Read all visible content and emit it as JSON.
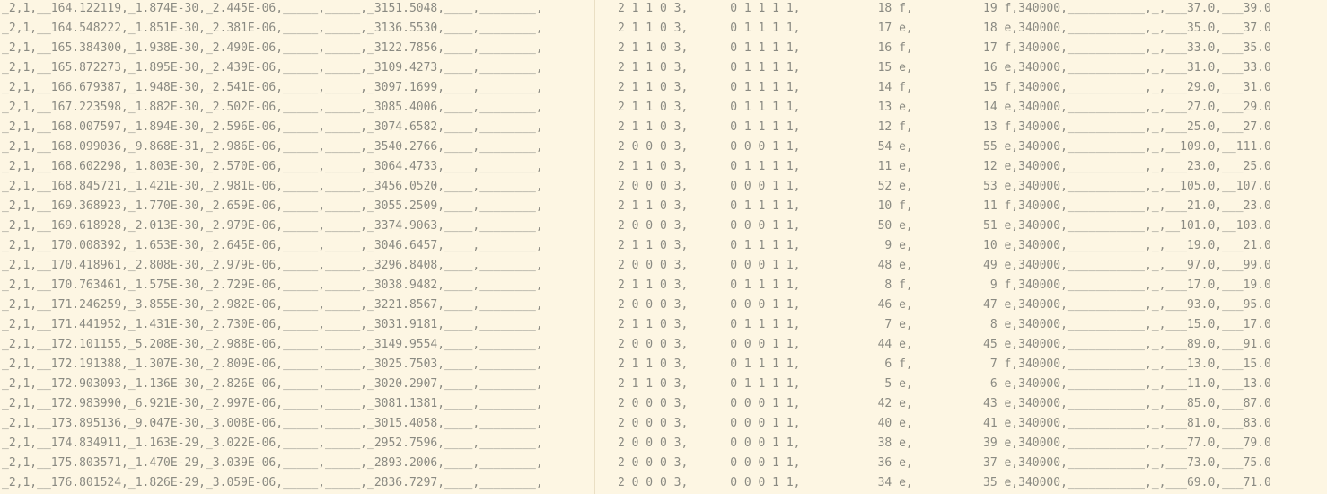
{
  "lines": [
    {
      "left": "_2,1,__164.122119,_1.874E-30,_2.445E-06,_____,_____,_3151.5048,____,________,",
      "right": "2 1 1 0 3,      0 1 1 1 1,           18 f,          19 f,340000,___________,_,___37.0,___39.0"
    },
    {
      "left": "_2,1,__164.548222,_1.851E-30,_2.381E-06,_____,_____,_3136.5530,____,________,",
      "right": "2 1 1 0 3,      0 1 1 1 1,           17 e,          18 e,340000,___________,_,___35.0,___37.0"
    },
    {
      "left": "_2,1,__165.384300,_1.938E-30,_2.490E-06,_____,_____,_3122.7856,____,________,",
      "right": "2 1 1 0 3,      0 1 1 1 1,           16 f,          17 f,340000,___________,_,___33.0,___35.0"
    },
    {
      "left": "_2,1,__165.872273,_1.895E-30,_2.439E-06,_____,_____,_3109.4273,____,________,",
      "right": "2 1 1 0 3,      0 1 1 1 1,           15 e,          16 e,340000,___________,_,___31.0,___33.0"
    },
    {
      "left": "_2,1,__166.679387,_1.948E-30,_2.541E-06,_____,_____,_3097.1699,____,________,",
      "right": "2 1 1 0 3,      0 1 1 1 1,           14 f,          15 f,340000,___________,_,___29.0,___31.0"
    },
    {
      "left": "_2,1,__167.223598,_1.882E-30,_2.502E-06,_____,_____,_3085.4006,____,________,",
      "right": "2 1 1 0 3,      0 1 1 1 1,           13 e,          14 e,340000,___________,_,___27.0,___29.0"
    },
    {
      "left": "_2,1,__168.007597,_1.894E-30,_2.596E-06,_____,_____,_3074.6582,____,________,",
      "right": "2 1 1 0 3,      0 1 1 1 1,           12 f,          13 f,340000,___________,_,___25.0,___27.0"
    },
    {
      "left": "_2,1,__168.099036,_9.868E-31,_2.986E-06,_____,_____,_3540.2766,____,________,",
      "right": "2 0 0 0 3,      0 0 0 1 1,           54 e,          55 e,340000,___________,_,__109.0,__111.0"
    },
    {
      "left": "_2,1,__168.602298,_1.803E-30,_2.570E-06,_____,_____,_3064.4733,____,________,",
      "right": "2 1 1 0 3,      0 1 1 1 1,           11 e,          12 e,340000,___________,_,___23.0,___25.0"
    },
    {
      "left": "_2,1,__168.845721,_1.421E-30,_2.981E-06,_____,_____,_3456.0520,____,________,",
      "right": "2 0 0 0 3,      0 0 0 1 1,           52 e,          53 e,340000,___________,_,__105.0,__107.0"
    },
    {
      "left": "_2,1,__169.368923,_1.770E-30,_2.659E-06,_____,_____,_3055.2509,____,________,",
      "right": "2 1 1 0 3,      0 1 1 1 1,           10 f,          11 f,340000,___________,_,___21.0,___23.0"
    },
    {
      "left": "_2,1,__169.618928,_2.013E-30,_2.979E-06,_____,_____,_3374.9063,____,________,",
      "right": "2 0 0 0 3,      0 0 0 1 1,           50 e,          51 e,340000,___________,_,__101.0,__103.0"
    },
    {
      "left": "_2,1,__170.008392,_1.653E-30,_2.645E-06,_____,_____,_3046.6457,____,________,",
      "right": "2 1 1 0 3,      0 1 1 1 1,            9 e,          10 e,340000,___________,_,___19.0,___21.0"
    },
    {
      "left": "_2,1,__170.418961,_2.808E-30,_2.979E-06,_____,_____,_3296.8408,____,________,",
      "right": "2 0 0 0 3,      0 0 0 1 1,           48 e,          49 e,340000,___________,_,___97.0,___99.0"
    },
    {
      "left": "_2,1,__170.763461,_1.575E-30,_2.729E-06,_____,_____,_3038.9482,____,________,",
      "right": "2 1 1 0 3,      0 1 1 1 1,            8 f,           9 f,340000,___________,_,___17.0,___19.0"
    },
    {
      "left": "_2,1,__171.246259,_3.855E-30,_2.982E-06,_____,_____,_3221.8567,____,________,",
      "right": "2 0 0 0 3,      0 0 0 1 1,           46 e,          47 e,340000,___________,_,___93.0,___95.0"
    },
    {
      "left": "_2,1,__171.441952,_1.431E-30,_2.730E-06,_____,_____,_3031.9181,____,________,",
      "right": "2 1 1 0 3,      0 1 1 1 1,            7 e,           8 e,340000,___________,_,___15.0,___17.0"
    },
    {
      "left": "_2,1,__172.101155,_5.208E-30,_2.988E-06,_____,_____,_3149.9554,____,________,",
      "right": "2 0 0 0 3,      0 0 0 1 1,           44 e,          45 e,340000,___________,_,___89.0,___91.0"
    },
    {
      "left": "_2,1,__172.191388,_1.307E-30,_2.809E-06,_____,_____,_3025.7503,____,________,",
      "right": "2 1 1 0 3,      0 1 1 1 1,            6 f,           7 f,340000,___________,_,___13.0,___15.0"
    },
    {
      "left": "_2,1,__172.903093,_1.136E-30,_2.826E-06,_____,_____,_3020.2907,____,________,",
      "right": "2 1 1 0 3,      0 1 1 1 1,            5 e,           6 e,340000,___________,_,___11.0,___13.0"
    },
    {
      "left": "_2,1,__172.983990,_6.921E-30,_2.997E-06,_____,_____,_3081.1381,____,________,",
      "right": "2 0 0 0 3,      0 0 0 1 1,           42 e,          43 e,340000,___________,_,___85.0,___87.0"
    },
    {
      "left": "_2,1,__173.895136,_9.047E-30,_3.008E-06,_____,_____,_3015.4058,____,________,",
      "right": "2 0 0 0 3,      0 0 0 1 1,           40 e,          41 e,340000,___________,_,___81.0,___83.0"
    },
    {
      "left": "_2,1,__174.834911,_1.163E-29,_3.022E-06,_____,_____,_2952.7596,____,________,",
      "right": "2 0 0 0 3,      0 0 0 1 1,           38 e,          39 e,340000,___________,_,___77.0,___79.0"
    },
    {
      "left": "_2,1,__175.803571,_1.470E-29,_3.039E-06,_____,_____,_2893.2006,____,________,",
      "right": "2 0 0 0 3,      0 0 0 1 1,           36 e,          37 e,340000,___________,_,___73.0,___75.0"
    },
    {
      "left": "_2,1,__176.801524,_1.826E-29,_3.059E-06,_____,_____,_2836.7297,____,________,",
      "right": "2 0 0 0 3,      0 0 0 1 1,           34 e,          35 e,340000,___________,_,___69.0,___71.0"
    }
  ]
}
